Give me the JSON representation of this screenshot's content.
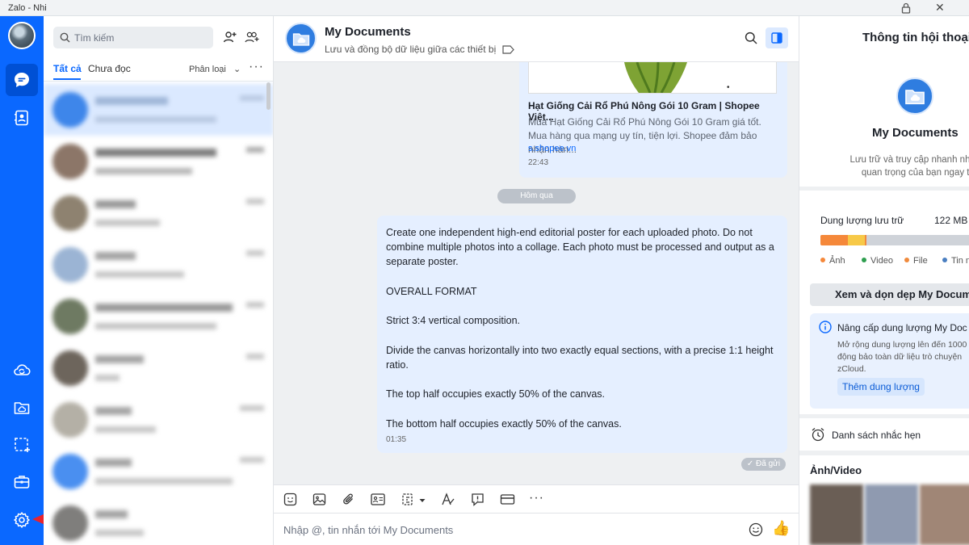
{
  "window": {
    "title": "Zalo - Nhi"
  },
  "search": {
    "placeholder": "Tìm kiếm"
  },
  "tabs": {
    "all": "Tất cả",
    "unread": "Chưa đọc",
    "filter": "Phân loại"
  },
  "chat": {
    "title": "My Documents",
    "subtitle": "Lưu và đồng bộ dữ liệu giữa các thiết bị",
    "link_card": {
      "title": "Hạt Giống Cải Rổ Phú Nông Gói 10 Gram | Shopee Việt...",
      "description": "Mua Hạt Giống Cải Rổ Phú Nông Gói 10 Gram giá tốt. Mua hàng qua mạng uy tín, tiện lợi. Shopee đảm bảo nhận hàn...",
      "host": "s.shopee.vn",
      "time": "22:43"
    },
    "date_separator": "Hôm qua",
    "message": {
      "paragraphs": [
        "Create one independent high-end editorial poster for each uploaded photo. Do not combine multiple photos into a collage. Each photo must be processed and output as a separate poster.",
        "OVERALL FORMAT",
        "Strict 3:4 vertical composition.",
        "Divide the canvas horizontally into two exactly equal sections, with a precise 1:1 height ratio.",
        "The top half occupies exactly 50% of the canvas.",
        "The bottom half occupies exactly 50% of the canvas."
      ],
      "time": "01:35",
      "status": "✓ Đã gửi"
    },
    "composer_placeholder": "Nhập @, tin nhắn tới My Documents"
  },
  "info_panel": {
    "title": "Thông tin hội thoại",
    "name": "My Documents",
    "description_line1": "Lưu trữ và truy cập nhanh những n",
    "description_line2": "quan trọng của bạn ngay trên",
    "storage_label": "Dung lượng lưu trữ",
    "storage_size": "122 MB",
    "storage_legend": [
      "Ảnh",
      "Video",
      "File",
      "Tin n"
    ],
    "clean_button": "Xem và dọn dẹp My Docum",
    "upgrade_title": "Nâng cấp dung lượng My Doc",
    "upgrade_line1": "Mở rộng dung lượng lên đến 1000",
    "upgrade_line2": "động bảo toàn dữ liệu trò chuyện",
    "upgrade_line3": "zCloud.",
    "upgrade_button": "Thêm dung lượng",
    "reminder_label": "Danh sách nhắc hẹn",
    "media_label": "Ảnh/Video"
  },
  "colors": {
    "brand": "#0a68ff",
    "storage_photo": "#f5883a",
    "storage_video": "#f7c948",
    "storage_file": "#f08a3c",
    "arrow": "#e8232d"
  }
}
